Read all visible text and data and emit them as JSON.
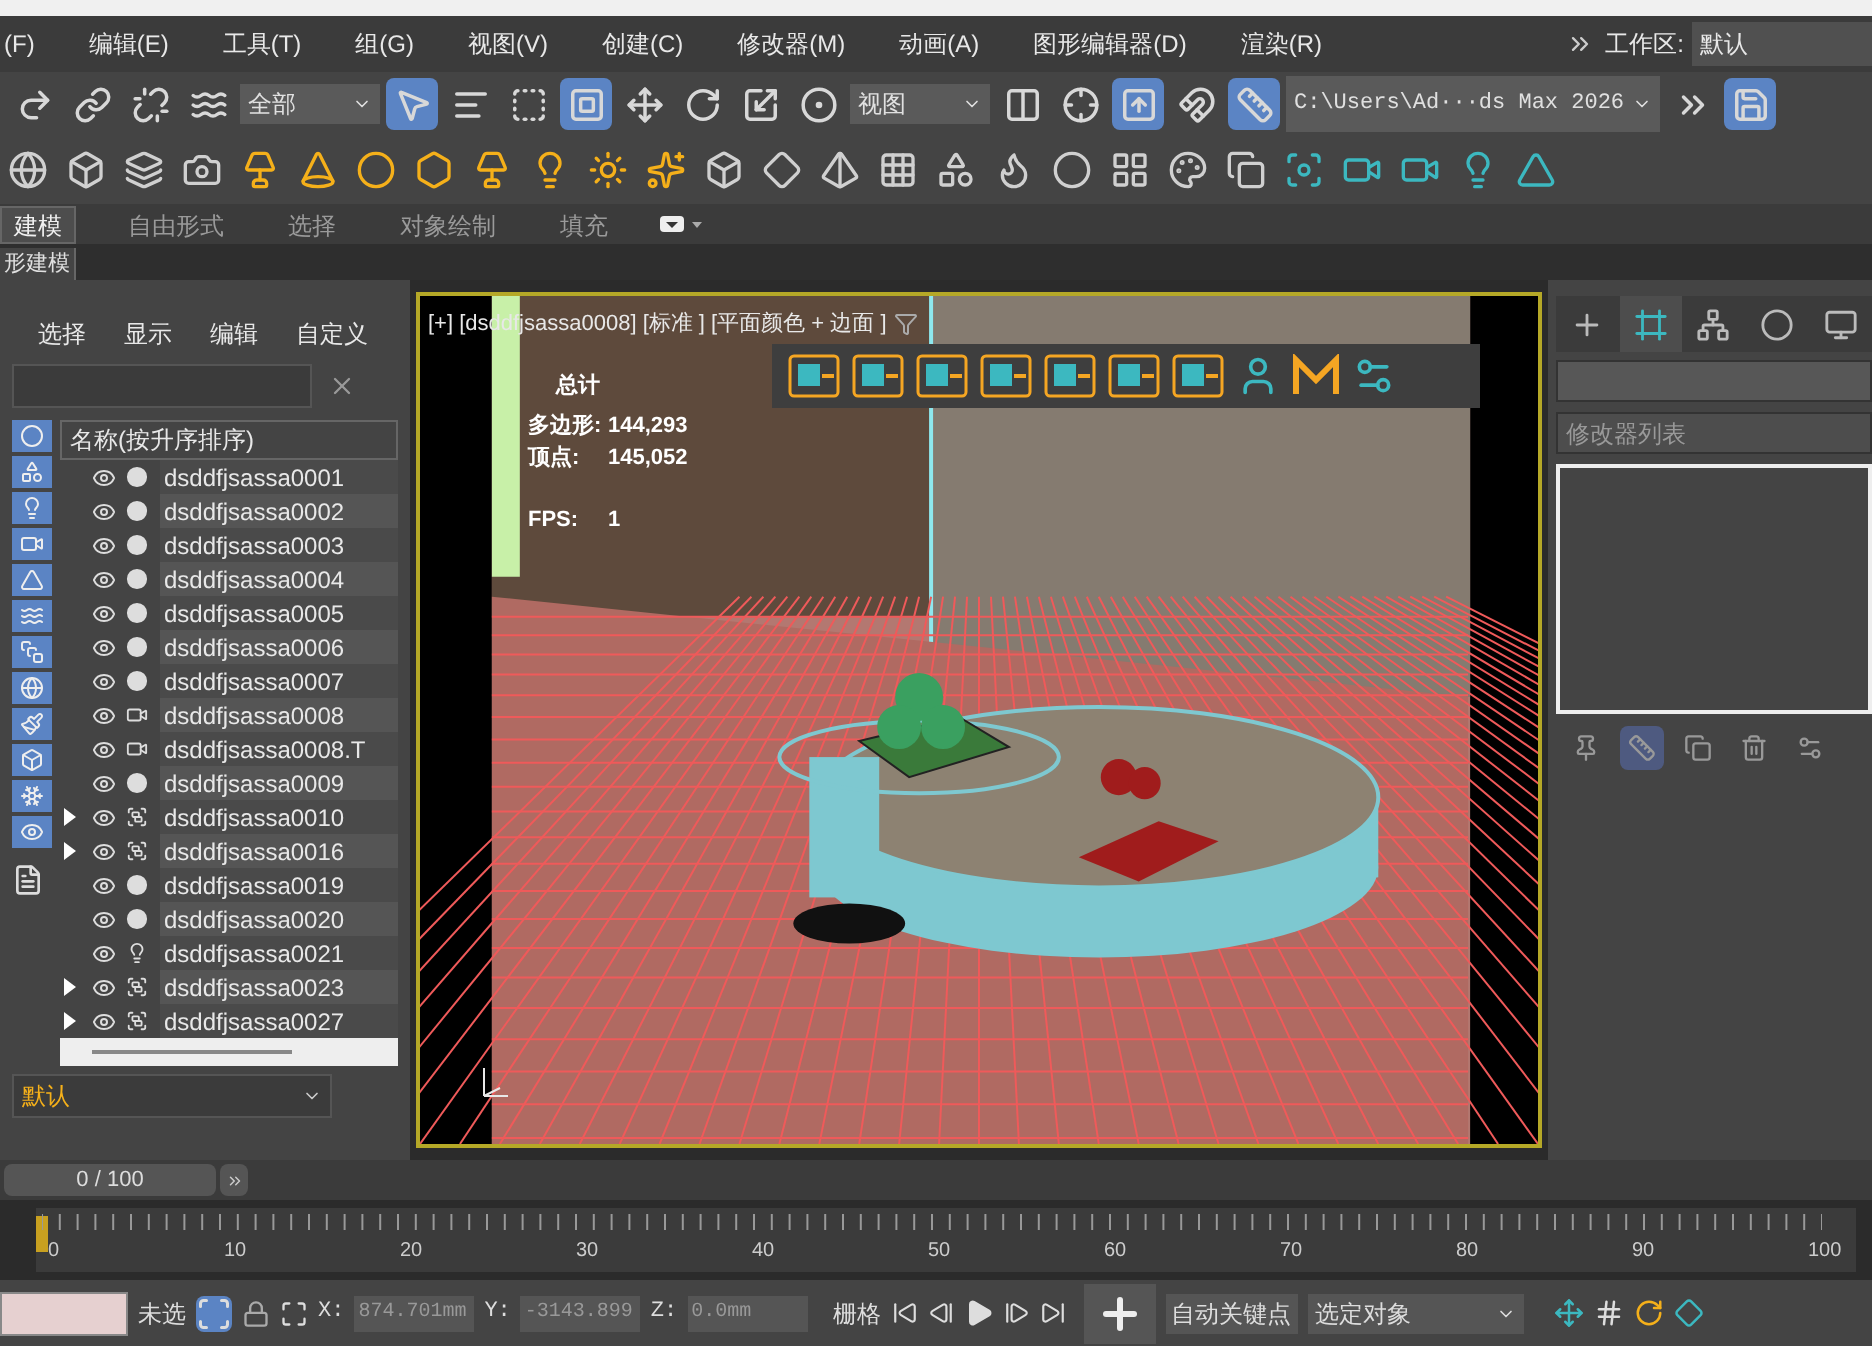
{
  "menu_bar": {
    "items": [
      "(F)",
      "编辑(E)",
      "工具(T)",
      "组(G)",
      "视图(V)",
      "创建(C)",
      "修改器(M)",
      "动画(A)",
      "图形编辑器(D)",
      "渲染(R)"
    ],
    "workspace_label": "工作区:",
    "workspace_value": "默认"
  },
  "main_toolbar": [
    {
      "kind": "button",
      "selected": false
    },
    {
      "kind": "button",
      "selected": false
    },
    {
      "kind": "button",
      "selected": false
    },
    {
      "kind": "button",
      "selected": false
    },
    {
      "kind": "dropdown",
      "value": "全部"
    },
    {
      "kind": "button",
      "selected": true
    },
    {
      "kind": "button",
      "selected": false
    },
    {
      "kind": "button",
      "selected": false
    },
    {
      "kind": "button",
      "selected": true
    },
    {
      "kind": "button",
      "selected": false
    },
    {
      "kind": "button",
      "selected": false
    },
    {
      "kind": "button",
      "selected": false
    },
    {
      "kind": "button",
      "selected": false
    },
    {
      "kind": "dropdown",
      "value": "视图"
    },
    {
      "kind": "button",
      "selected": false
    },
    {
      "kind": "button",
      "selected": false
    },
    {
      "kind": "button",
      "selected": true
    },
    {
      "kind": "button",
      "selected": false
    },
    {
      "kind": "button",
      "selected": true
    },
    {
      "kind": "path",
      "value": "C:\\Users\\Ad···ds Max 2026"
    },
    {
      "kind": "button",
      "selected": false
    },
    {
      "kind": "button",
      "selected": true
    }
  ],
  "ribbon": {
    "tabs": [
      {
        "label": "建模",
        "selected": true
      },
      {
        "label": "自由形式",
        "selected": false
      },
      {
        "label": "选择",
        "selected": false
      },
      {
        "label": "对象绘制",
        "selected": false
      },
      {
        "label": "填充",
        "selected": false
      }
    ],
    "panel_label": "形建模"
  },
  "scene_explorer": {
    "menus": [
      "选择",
      "显示",
      "编辑",
      "自定义"
    ],
    "column_header": "名称(按升序排序)",
    "rows": [
      {
        "name": "dsddfjsassa0001",
        "kind": "geometry",
        "has_children": false
      },
      {
        "name": "dsddfjsassa0002",
        "kind": "geometry",
        "has_children": false
      },
      {
        "name": "dsddfjsassa0003",
        "kind": "geometry",
        "has_children": false
      },
      {
        "name": "dsddfjsassa0004",
        "kind": "geometry",
        "has_children": false
      },
      {
        "name": "dsddfjsassa0005",
        "kind": "geometry",
        "has_children": false
      },
      {
        "name": "dsddfjsassa0006",
        "kind": "geometry",
        "has_children": false
      },
      {
        "name": "dsddfjsassa0007",
        "kind": "geometry",
        "has_children": false
      },
      {
        "name": "dsddfjsassa0008",
        "kind": "camera",
        "has_children": false
      },
      {
        "name": "dsddfjsassa0008.T",
        "kind": "camera",
        "has_children": false
      },
      {
        "name": "dsddfjsassa0009",
        "kind": "geometry",
        "has_children": false
      },
      {
        "name": "dsddfjsassa0010",
        "kind": "group",
        "has_children": true
      },
      {
        "name": "dsddfjsassa0016",
        "kind": "group",
        "has_children": true
      },
      {
        "name": "dsddfjsassa0019",
        "kind": "geometry",
        "has_children": false
      },
      {
        "name": "dsddfjsassa0020",
        "kind": "geometry",
        "has_children": false
      },
      {
        "name": "dsddfjsassa0021",
        "kind": "light",
        "has_children": false
      },
      {
        "name": "dsddfjsassa0023",
        "kind": "group",
        "has_children": true
      },
      {
        "name": "dsddfjsassa0027",
        "kind": "group",
        "has_children": true
      }
    ],
    "layer_dropdown": "默认"
  },
  "viewport": {
    "label": "[+] [dsddfjsassa0008] [标准 ] [平面颜色 + 边面 ]",
    "stats_title": "总计",
    "stats": [
      {
        "label": "多边形:",
        "value": "144,293"
      },
      {
        "label": "顶点:",
        "value": "145,052"
      },
      {
        "label": "FPS:",
        "value": "1"
      }
    ]
  },
  "command_panel": {
    "tabs": [
      {
        "selected": false
      },
      {
        "selected": true
      },
      {
        "selected": false
      },
      {
        "selected": false
      },
      {
        "selected": false
      }
    ],
    "modifier_list": "修改器列表",
    "stack_buttons": [
      {
        "selected": false
      },
      {
        "selected": true
      },
      {
        "selected": false
      },
      {
        "selected": false
      },
      {
        "selected": false
      }
    ]
  },
  "time_slider": {
    "reading": "0 / 100",
    "level": 0
  },
  "track_bar": {
    "labels": [
      "0",
      "10",
      "20",
      "30",
      "40",
      "50",
      "60",
      "70",
      "80",
      "90",
      "100"
    ]
  },
  "status_bar": {
    "selection": "未选",
    "x_label": "X:",
    "x_value": "874.701mm",
    "y_label": "Y:",
    "y_value": "-3143.899",
    "z_label": "Z:",
    "z_value": "0.0mm",
    "grid_label": "栅格",
    "auto_key": "自动关键点",
    "key_filter": "选定对象"
  }
}
